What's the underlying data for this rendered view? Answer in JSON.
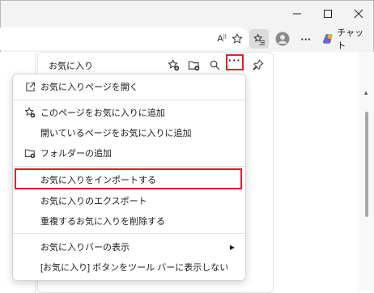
{
  "toolbar": {
    "read_aloud_label": "A",
    "chat_label": "チャット"
  },
  "favorites_panel": {
    "title": "お気に入り"
  },
  "more_menu": {
    "items": [
      {
        "label": "お気に入りページを開く",
        "icon": "open-external-icon"
      },
      {
        "label": "このページをお気に入りに追加",
        "icon": "star-add-icon"
      },
      {
        "label": "開いているページをお気に入りに追加",
        "icon": ""
      },
      {
        "label": "フォルダーの追加",
        "icon": "folder-add-icon"
      },
      {
        "label": "お気に入りをインポートする",
        "icon": "",
        "highlighted": true
      },
      {
        "label": "お気に入りのエクスポート",
        "icon": ""
      },
      {
        "label": "重複するお気に入りを削除する",
        "icon": ""
      },
      {
        "label": "お気に入りバーの表示",
        "icon": "",
        "submenu": true
      },
      {
        "label": "[お気に入り] ボタンをツール バーに表示しない",
        "icon": ""
      }
    ]
  },
  "colors": {
    "highlight_box": "#e0202c",
    "chat_gradient_start": "#1e88e5",
    "chat_gradient_end": "#ab47bc"
  }
}
